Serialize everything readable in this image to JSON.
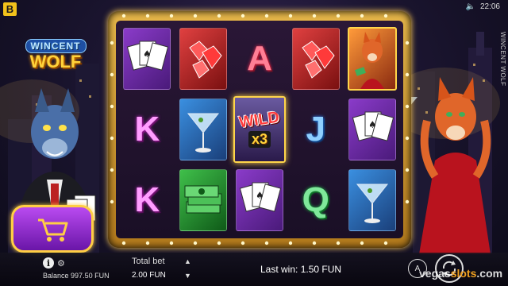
{
  "topbar": {
    "brand_letter": "B",
    "time": "22:06",
    "vertical_title": "WINCENT WOLF"
  },
  "logo": {
    "line1": "WINCENT",
    "line2": "WOLF"
  },
  "reels": [
    [
      "cards-icon",
      "rubies-icon",
      "A",
      "rubies-icon",
      "fox-lady-icon"
    ],
    [
      "K",
      "martini-icon",
      "WILD",
      "J",
      "cards-icon"
    ],
    [
      "K",
      "money-icon",
      "cards-icon",
      "Q",
      "martini-icon"
    ]
  ],
  "wild": {
    "label": "WILD",
    "multiplier": "x3"
  },
  "bottom": {
    "balance_label": "Balance",
    "balance_value": "997.50 FUN",
    "total_bet_label": "Total bet",
    "total_bet_value": "2.00 FUN",
    "last_win": "Last win: 1.50 FUN",
    "auto_label": "A"
  },
  "watermark": {
    "part1": "vegas",
    "part2": "slots",
    "part3": ".com"
  },
  "colors": {
    "frame_gold": "#e8b84a",
    "cart_purple": "#9a2ad8",
    "reel_bg": "#2a1736"
  }
}
